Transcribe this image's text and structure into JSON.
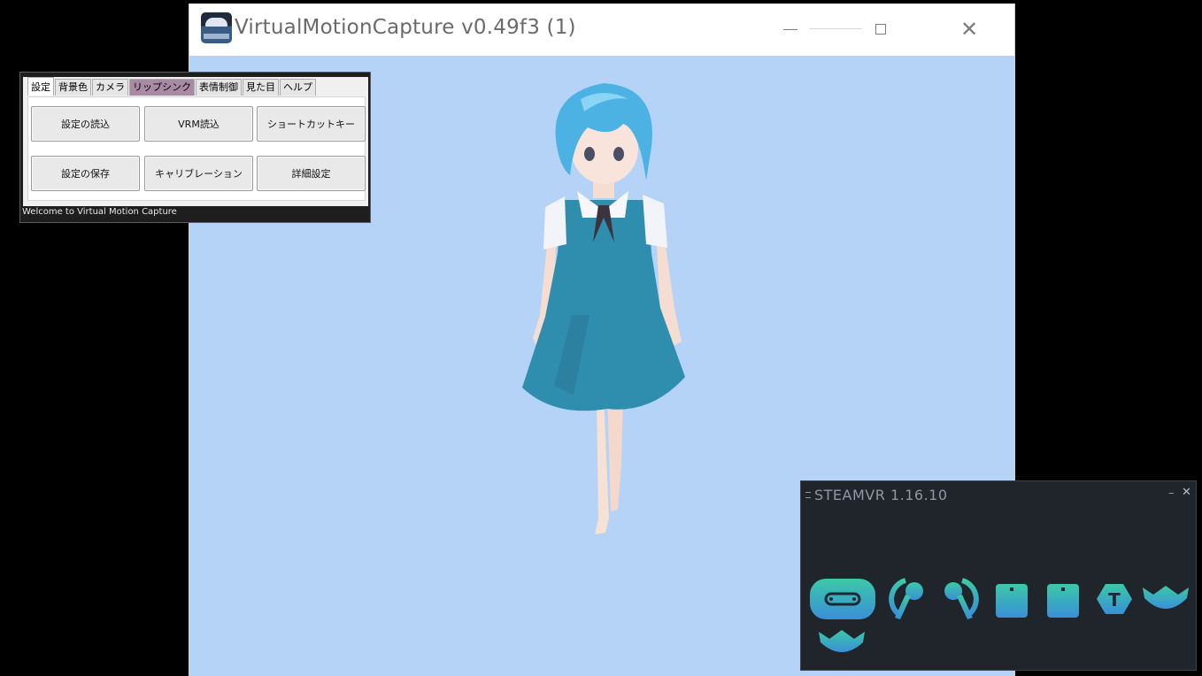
{
  "main_window": {
    "title": "VirtualMotionCapture v0.49f3 (1)",
    "background_color": "#b5d3f6"
  },
  "settings": {
    "tabs": [
      "設定",
      "背景色",
      "カメラ",
      "リップシンク",
      "表情制御",
      "見た目",
      "ヘルプ"
    ],
    "active_tab": "設定",
    "highlighted_tab": "リップシンク",
    "buttons": {
      "load_settings": "設定の読込",
      "load_vrm": "VRM読込",
      "shortcut_keys": "ショートカットキー",
      "save_settings": "設定の保存",
      "calibration": "キャリブレーション",
      "advanced_settings": "詳細設定"
    },
    "status": "Welcome to Virtual Motion Capture"
  },
  "steamvr": {
    "title": "STEAMVR 1.16.10",
    "accent_colors": [
      "#3bc9a6",
      "#3a8fd8"
    ],
    "devices": [
      "headset-icon",
      "controller-left-icon",
      "controller-right-icon",
      "base-station-icon",
      "base-station-icon",
      "tracker-icon",
      "vive-tracker-icon",
      "vive-tracker-icon"
    ]
  }
}
